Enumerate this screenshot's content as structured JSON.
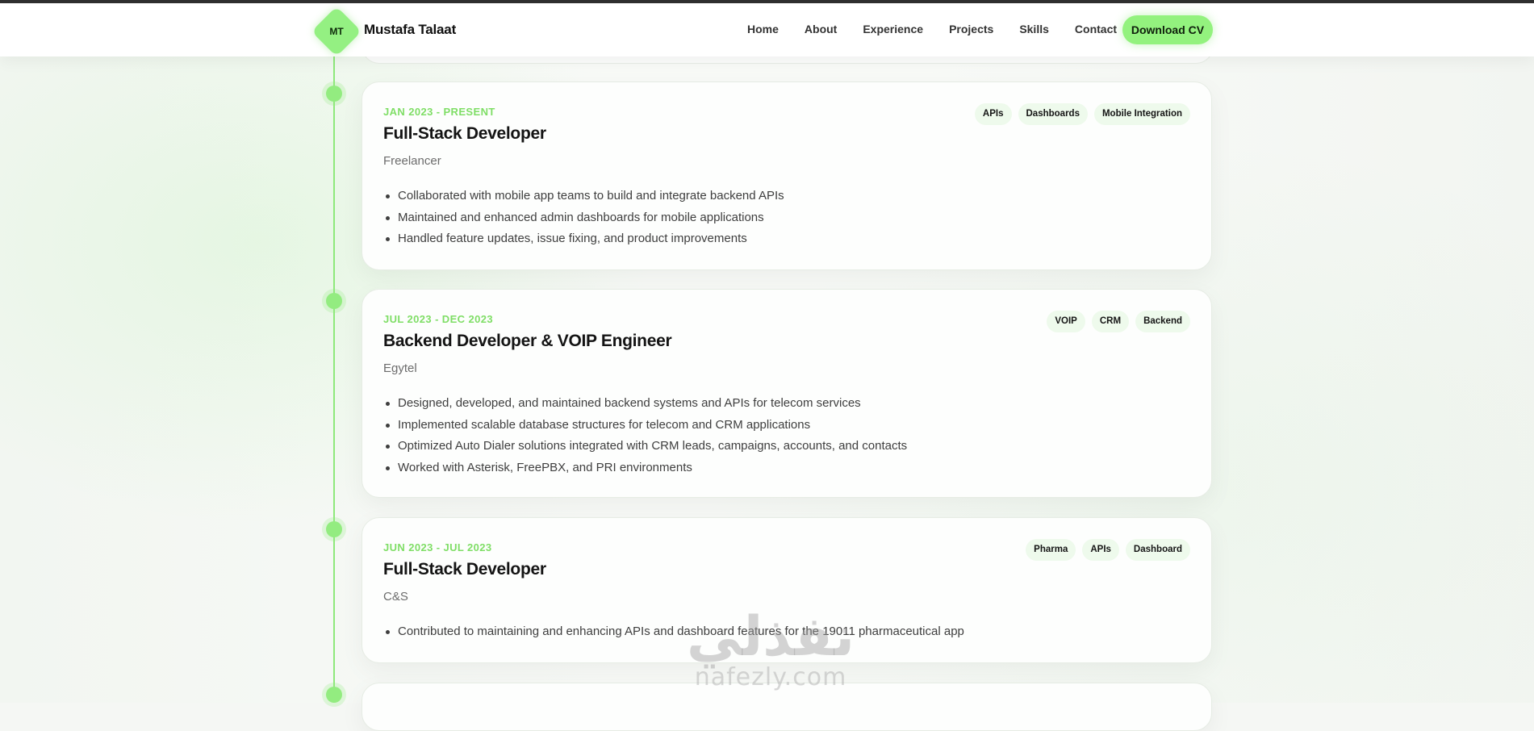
{
  "header": {
    "logo_initials": "MT",
    "brand_name": "Mustafa Talaat",
    "nav": [
      "Home",
      "About",
      "Experience",
      "Projects",
      "Skills",
      "Contact"
    ],
    "cta_label": "Download CV"
  },
  "experience": [
    {
      "period": "JAN 2023 - PRESENT",
      "role": "Full-Stack Developer",
      "company": "Freelancer",
      "tags": [
        "APIs",
        "Dashboards",
        "Mobile Integration"
      ],
      "bullets": [
        "Collaborated with mobile app teams to build and integrate backend APIs",
        "Maintained and enhanced admin dashboards for mobile applications",
        "Handled feature updates, issue fixing, and product improvements"
      ]
    },
    {
      "period": "JUL 2023 - DEC 2023",
      "role": "Backend Developer & VOIP Engineer",
      "company": "Egytel",
      "tags": [
        "VOIP",
        "CRM",
        "Backend"
      ],
      "bullets": [
        "Designed, developed, and maintained backend systems and APIs for telecom services",
        "Implemented scalable database structures for telecom and CRM applications",
        "Optimized Auto Dialer solutions integrated with CRM leads, campaigns, accounts, and contacts",
        "Worked with Asterisk, FreePBX, and PRI environments"
      ]
    },
    {
      "period": "JUN 2023 - JUL 2023",
      "role": "Full-Stack Developer",
      "company": "C&S",
      "tags": [
        "Pharma",
        "APIs",
        "Dashboard"
      ],
      "bullets": [
        "Contributed to maintaining and enhancing APIs and dashboard features for the 19011 pharmaceutical app"
      ]
    }
  ],
  "watermark": {
    "arabic": "نفذلي",
    "latin": "nafezly.com"
  },
  "colors": {
    "accent": "#93f27e",
    "accent_text": "#7fde66",
    "tag_bg": "#eefaec"
  }
}
